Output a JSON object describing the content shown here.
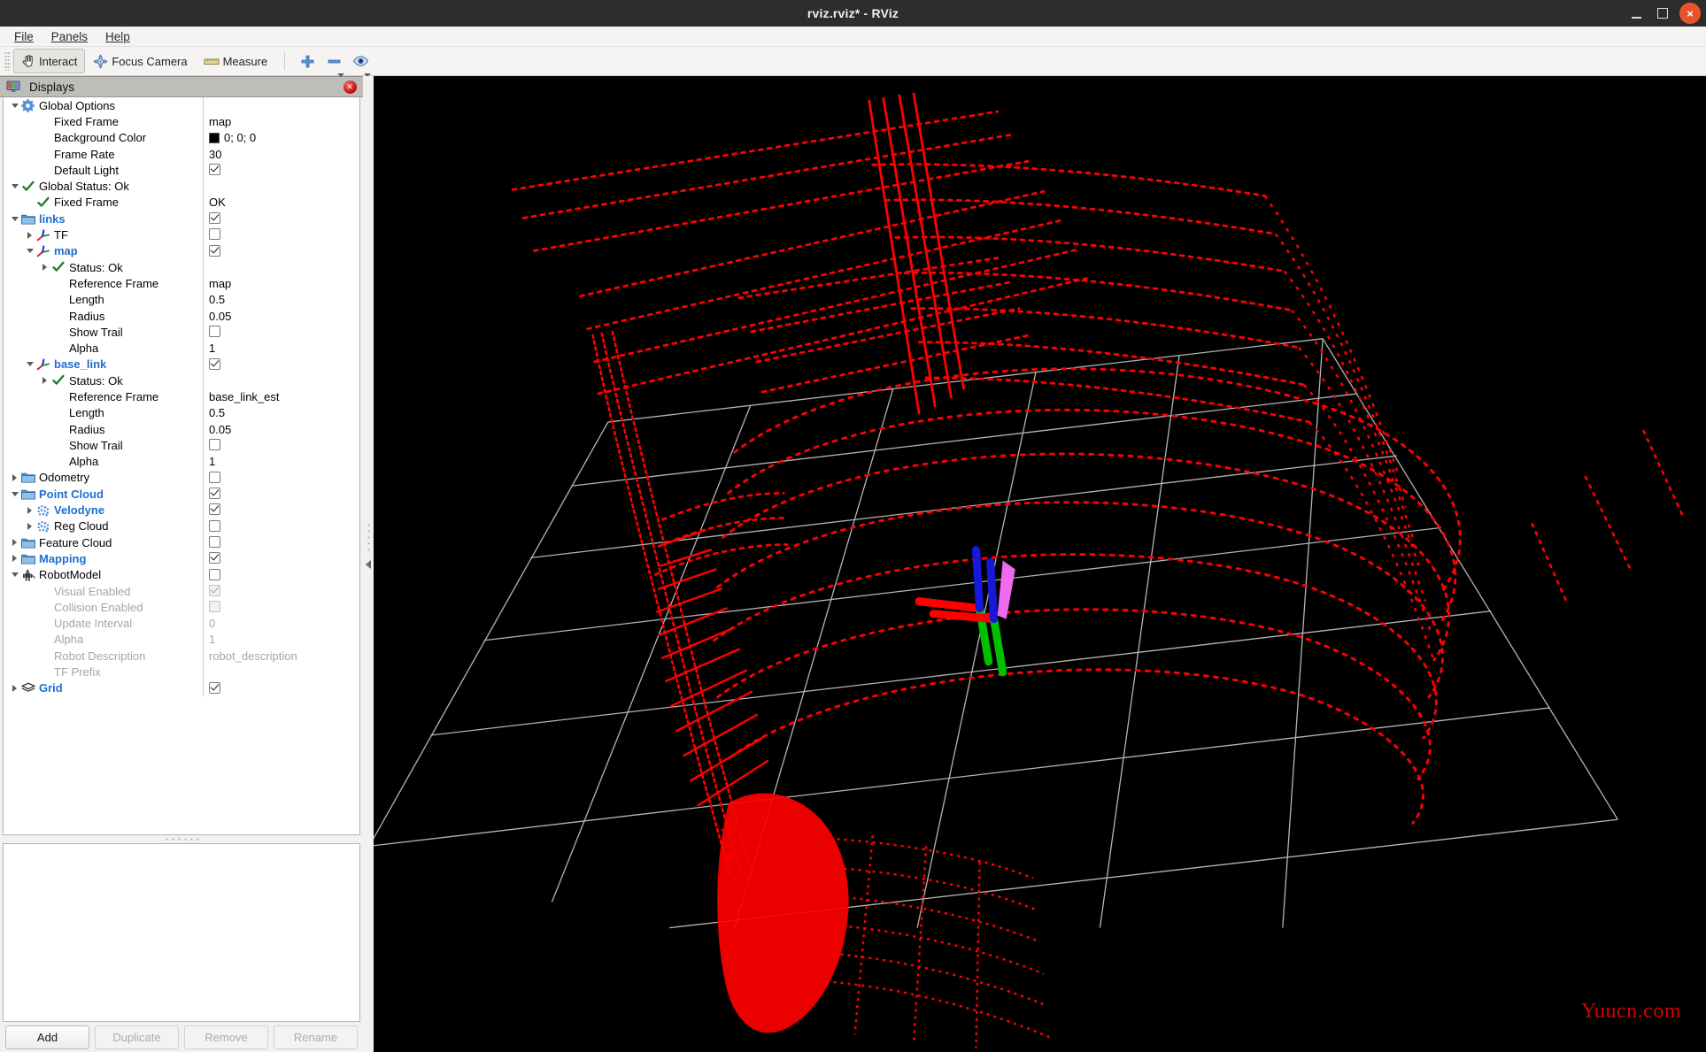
{
  "window": {
    "title": "rviz.rviz* - RViz",
    "minimize_label": "minimize",
    "maximize_label": "maximize",
    "close_label": "×"
  },
  "menubar": {
    "items": [
      {
        "label": "File",
        "mnemonic": "F"
      },
      {
        "label": "Panels",
        "mnemonic": "P"
      },
      {
        "label": "Help",
        "mnemonic": "H"
      }
    ]
  },
  "toolbar": {
    "buttons": [
      {
        "label": "Interact",
        "icon": "hand-cursor-icon",
        "active": true
      },
      {
        "label": "Focus Camera",
        "icon": "focus-camera-icon",
        "active": false
      },
      {
        "label": "Measure",
        "icon": "ruler-icon",
        "active": false
      }
    ],
    "icon_buttons": [
      {
        "name": "add-tool-icon",
        "glyph": "+",
        "color": "#4a86d8",
        "has_caret": false
      },
      {
        "name": "remove-tool-icon",
        "glyph": "−",
        "color": "#4a86d8",
        "has_caret": true
      },
      {
        "name": "visibility-eye-icon",
        "glyph": "eye",
        "color": "#4a86d8",
        "has_caret": true
      }
    ]
  },
  "displays_panel": {
    "title": "Displays",
    "icon": "displays-monitor-icon",
    "close_icon": "panel-close-icon",
    "tree": [
      {
        "indent": 0,
        "arrow": "open",
        "icon": "gear-icon",
        "label": "Global Options",
        "style": "normal",
        "value_type": "none"
      },
      {
        "indent": 1,
        "arrow": "none",
        "icon": "none",
        "label": "Fixed Frame",
        "style": "normal",
        "value_type": "text",
        "value": "map"
      },
      {
        "indent": 1,
        "arrow": "none",
        "icon": "none",
        "label": "Background Color",
        "style": "normal",
        "value_type": "color",
        "value": "0; 0; 0",
        "color": "#000000"
      },
      {
        "indent": 1,
        "arrow": "none",
        "icon": "none",
        "label": "Frame Rate",
        "style": "normal",
        "value_type": "text",
        "value": "30"
      },
      {
        "indent": 1,
        "arrow": "none",
        "icon": "none",
        "label": "Default Light",
        "style": "normal",
        "value_type": "check",
        "checked": true
      },
      {
        "indent": 0,
        "arrow": "open",
        "icon": "check-ok-icon",
        "label": "Global Status: Ok",
        "style": "normal",
        "value_type": "none"
      },
      {
        "indent": 1,
        "arrow": "none",
        "icon": "check-ok-icon",
        "label": "Fixed Frame",
        "style": "normal",
        "value_type": "text",
        "value": "OK"
      },
      {
        "indent": 0,
        "arrow": "open",
        "icon": "folder-icon",
        "label": "links",
        "style": "bold",
        "value_type": "check",
        "checked": true
      },
      {
        "indent": 1,
        "arrow": "closed",
        "icon": "axes-icon",
        "label": "TF",
        "style": "normal",
        "value_type": "check",
        "checked": false
      },
      {
        "indent": 1,
        "arrow": "open",
        "icon": "axes-icon",
        "label": "map",
        "style": "bold",
        "value_type": "check",
        "checked": true
      },
      {
        "indent": 2,
        "arrow": "closed",
        "icon": "check-ok-icon",
        "label": "Status: Ok",
        "style": "normal",
        "value_type": "none"
      },
      {
        "indent": 2,
        "arrow": "none",
        "icon": "none",
        "label": "Reference Frame",
        "style": "normal",
        "value_type": "text",
        "value": "map"
      },
      {
        "indent": 2,
        "arrow": "none",
        "icon": "none",
        "label": "Length",
        "style": "normal",
        "value_type": "text",
        "value": "0.5"
      },
      {
        "indent": 2,
        "arrow": "none",
        "icon": "none",
        "label": "Radius",
        "style": "normal",
        "value_type": "text",
        "value": "0.05"
      },
      {
        "indent": 2,
        "arrow": "none",
        "icon": "none",
        "label": "Show Trail",
        "style": "normal",
        "value_type": "check",
        "checked": false
      },
      {
        "indent": 2,
        "arrow": "none",
        "icon": "none",
        "label": "Alpha",
        "style": "normal",
        "value_type": "text",
        "value": "1"
      },
      {
        "indent": 1,
        "arrow": "open",
        "icon": "axes-icon",
        "label": "base_link",
        "style": "bold",
        "value_type": "check",
        "checked": true
      },
      {
        "indent": 2,
        "arrow": "closed",
        "icon": "check-ok-icon",
        "label": "Status: Ok",
        "style": "normal",
        "value_type": "none"
      },
      {
        "indent": 2,
        "arrow": "none",
        "icon": "none",
        "label": "Reference Frame",
        "style": "normal",
        "value_type": "text",
        "value": "base_link_est"
      },
      {
        "indent": 2,
        "arrow": "none",
        "icon": "none",
        "label": "Length",
        "style": "normal",
        "value_type": "text",
        "value": "0.5"
      },
      {
        "indent": 2,
        "arrow": "none",
        "icon": "none",
        "label": "Radius",
        "style": "normal",
        "value_type": "text",
        "value": "0.05"
      },
      {
        "indent": 2,
        "arrow": "none",
        "icon": "none",
        "label": "Show Trail",
        "style": "normal",
        "value_type": "check",
        "checked": false
      },
      {
        "indent": 2,
        "arrow": "none",
        "icon": "none",
        "label": "Alpha",
        "style": "normal",
        "value_type": "text",
        "value": "1"
      },
      {
        "indent": 0,
        "arrow": "closed",
        "icon": "folder-icon",
        "label": "Odometry",
        "style": "normal",
        "value_type": "check",
        "checked": false
      },
      {
        "indent": 0,
        "arrow": "open",
        "icon": "folder-icon",
        "label": "Point Cloud",
        "style": "bold",
        "value_type": "check",
        "checked": true
      },
      {
        "indent": 1,
        "arrow": "closed",
        "icon": "pointcloud-icon",
        "label": "Velodyne",
        "style": "bold",
        "value_type": "check",
        "checked": true
      },
      {
        "indent": 1,
        "arrow": "closed",
        "icon": "pointcloud-icon",
        "label": "Reg Cloud",
        "style": "normal",
        "value_type": "check",
        "checked": false
      },
      {
        "indent": 0,
        "arrow": "closed",
        "icon": "folder-icon",
        "label": "Feature Cloud",
        "style": "normal",
        "value_type": "check",
        "checked": false
      },
      {
        "indent": 0,
        "arrow": "closed",
        "icon": "folder-icon",
        "label": "Mapping",
        "style": "bold",
        "value_type": "check",
        "checked": true
      },
      {
        "indent": 0,
        "arrow": "open",
        "icon": "robot-icon",
        "label": "RobotModel",
        "style": "normal",
        "value_type": "check",
        "checked": false
      },
      {
        "indent": 1,
        "arrow": "none",
        "icon": "none",
        "label": "Visual Enabled",
        "style": "dim",
        "value_type": "check",
        "checked": true
      },
      {
        "indent": 1,
        "arrow": "none",
        "icon": "none",
        "label": "Collision Enabled",
        "style": "dim",
        "value_type": "check",
        "checked": false
      },
      {
        "indent": 1,
        "arrow": "none",
        "icon": "none",
        "label": "Update Interval",
        "style": "dim",
        "value_type": "text",
        "value": "0"
      },
      {
        "indent": 1,
        "arrow": "none",
        "icon": "none",
        "label": "Alpha",
        "style": "dim",
        "value_type": "text",
        "value": "1"
      },
      {
        "indent": 1,
        "arrow": "none",
        "icon": "none",
        "label": "Robot Description",
        "style": "dim",
        "value_type": "text",
        "value": "robot_description"
      },
      {
        "indent": 1,
        "arrow": "none",
        "icon": "none",
        "label": "TF Prefix",
        "style": "dim",
        "value_type": "none"
      },
      {
        "indent": 0,
        "arrow": "closed",
        "icon": "grid-icon",
        "label": "Grid",
        "style": "bold",
        "value_type": "check",
        "checked": true
      }
    ]
  },
  "footer_buttons": [
    {
      "label": "Add",
      "enabled": true
    },
    {
      "label": "Duplicate",
      "enabled": false
    },
    {
      "label": "Remove",
      "enabled": false
    },
    {
      "label": "Rename",
      "enabled": false
    }
  ],
  "view3d": {
    "background_color": "#000000",
    "pointcloud_color": "#ff0000",
    "grid_color": "#b4b4b4",
    "axes": {
      "x_color": "#ff0000",
      "y_color": "#00c000",
      "z_color": "#1818d8",
      "arrow_color": "#ee6aee"
    },
    "watermark": "Yuucn.com",
    "watermark_color": "#d40000",
    "splitter_icon": "collapse-left-arrow-icon"
  }
}
